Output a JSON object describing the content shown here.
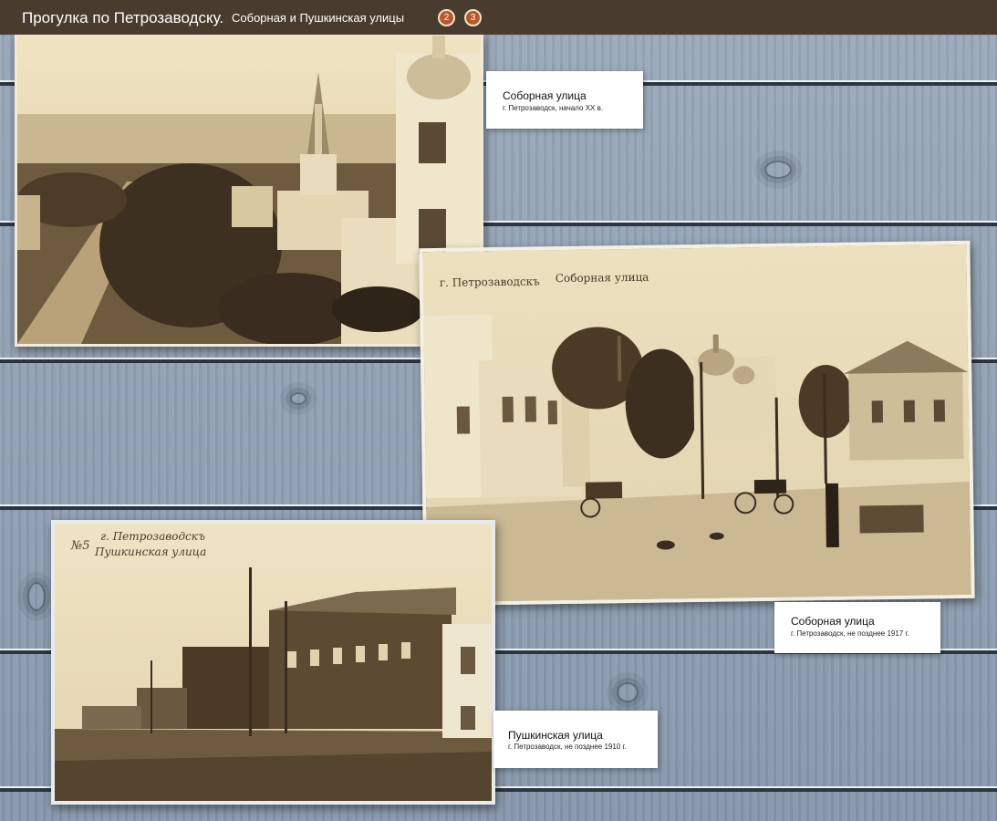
{
  "header": {
    "title": "Прогулка по Петрозаводску.",
    "subtitle": "Соборная и Пушкинская улицы",
    "pages": [
      "2",
      "3"
    ]
  },
  "photos": [
    {
      "caption_title": "Соборная улица",
      "caption_sub": "г. Петрозаводск, начало XX в."
    },
    {
      "postcard_text_1": "г. Петрозаводскъ",
      "postcard_text_2": "Соборная улица",
      "caption_title": "Соборная улица",
      "caption_sub": "г. Петрозаводск, не позднее 1917 г."
    },
    {
      "postcard_number": "№5",
      "postcard_text_1": "г. Петрозаводскъ",
      "postcard_text_2": "Пушкинская улица",
      "caption_title": "Пушкинская улица",
      "caption_sub": "г. Петрозаводск, не позднее 1910 г."
    }
  ],
  "colors": {
    "header_bg": "#4a3b2f",
    "page_button": "#b65a2c",
    "sepia_light": "#e6d8b6",
    "sepia_dark": "#3a2d1f"
  }
}
